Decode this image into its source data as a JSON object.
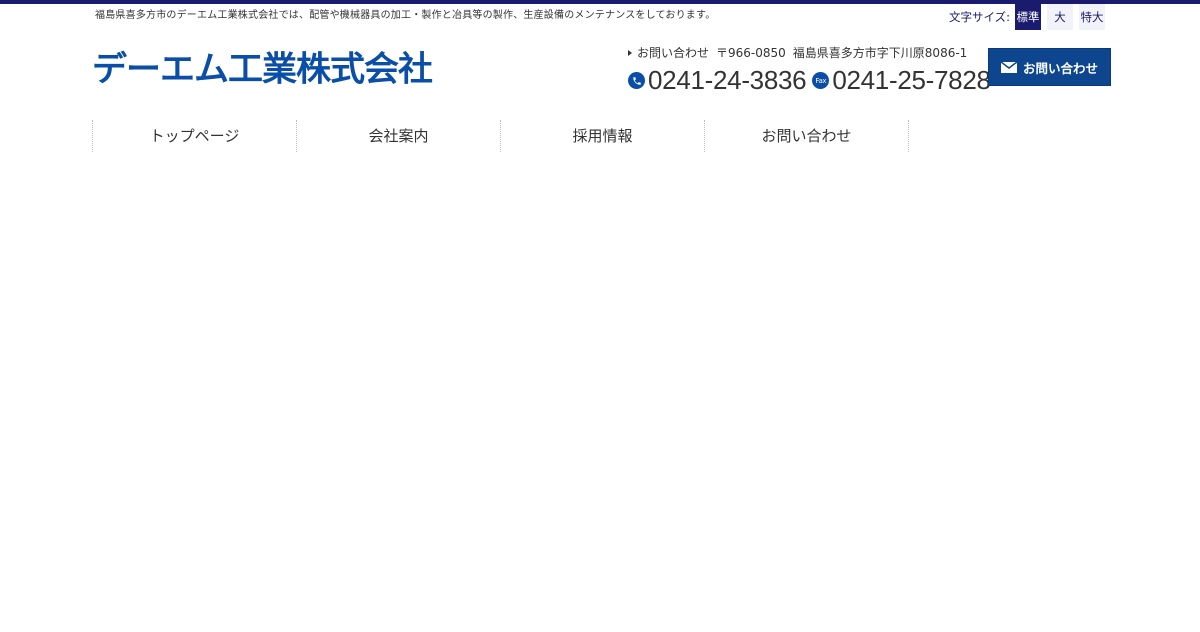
{
  "header": {
    "tagline": "福島県喜多方市のデーエム工業株式会社では、配管や機械器具の加工・製作と冶具等の製作、生産設備のメンテナンスをしております。",
    "font_size": {
      "label": "文字サイズ:",
      "options": [
        "標準",
        "大",
        "特大"
      ],
      "selected": "標準"
    },
    "logo_text": "デーエム工業株式会社",
    "brand_color": "#0a4ea8",
    "accent_color": "#1a1a6e"
  },
  "contact": {
    "label": "お問い合わせ",
    "postal": "〒966-0850",
    "address": "福島県喜多方市字下川原8086-1",
    "tel": "0241-24-3836",
    "fax": "0241-25-7828",
    "tel_icon": "phone-icon",
    "fax_icon": "fax-icon",
    "fax_icon_text": "Fax",
    "button_label": "お問い合わせ",
    "button_icon": "mail-icon"
  },
  "nav": {
    "items": [
      {
        "label": "トップページ"
      },
      {
        "label": "会社案内"
      },
      {
        "label": "採用情報"
      },
      {
        "label": "お問い合わせ"
      }
    ]
  }
}
